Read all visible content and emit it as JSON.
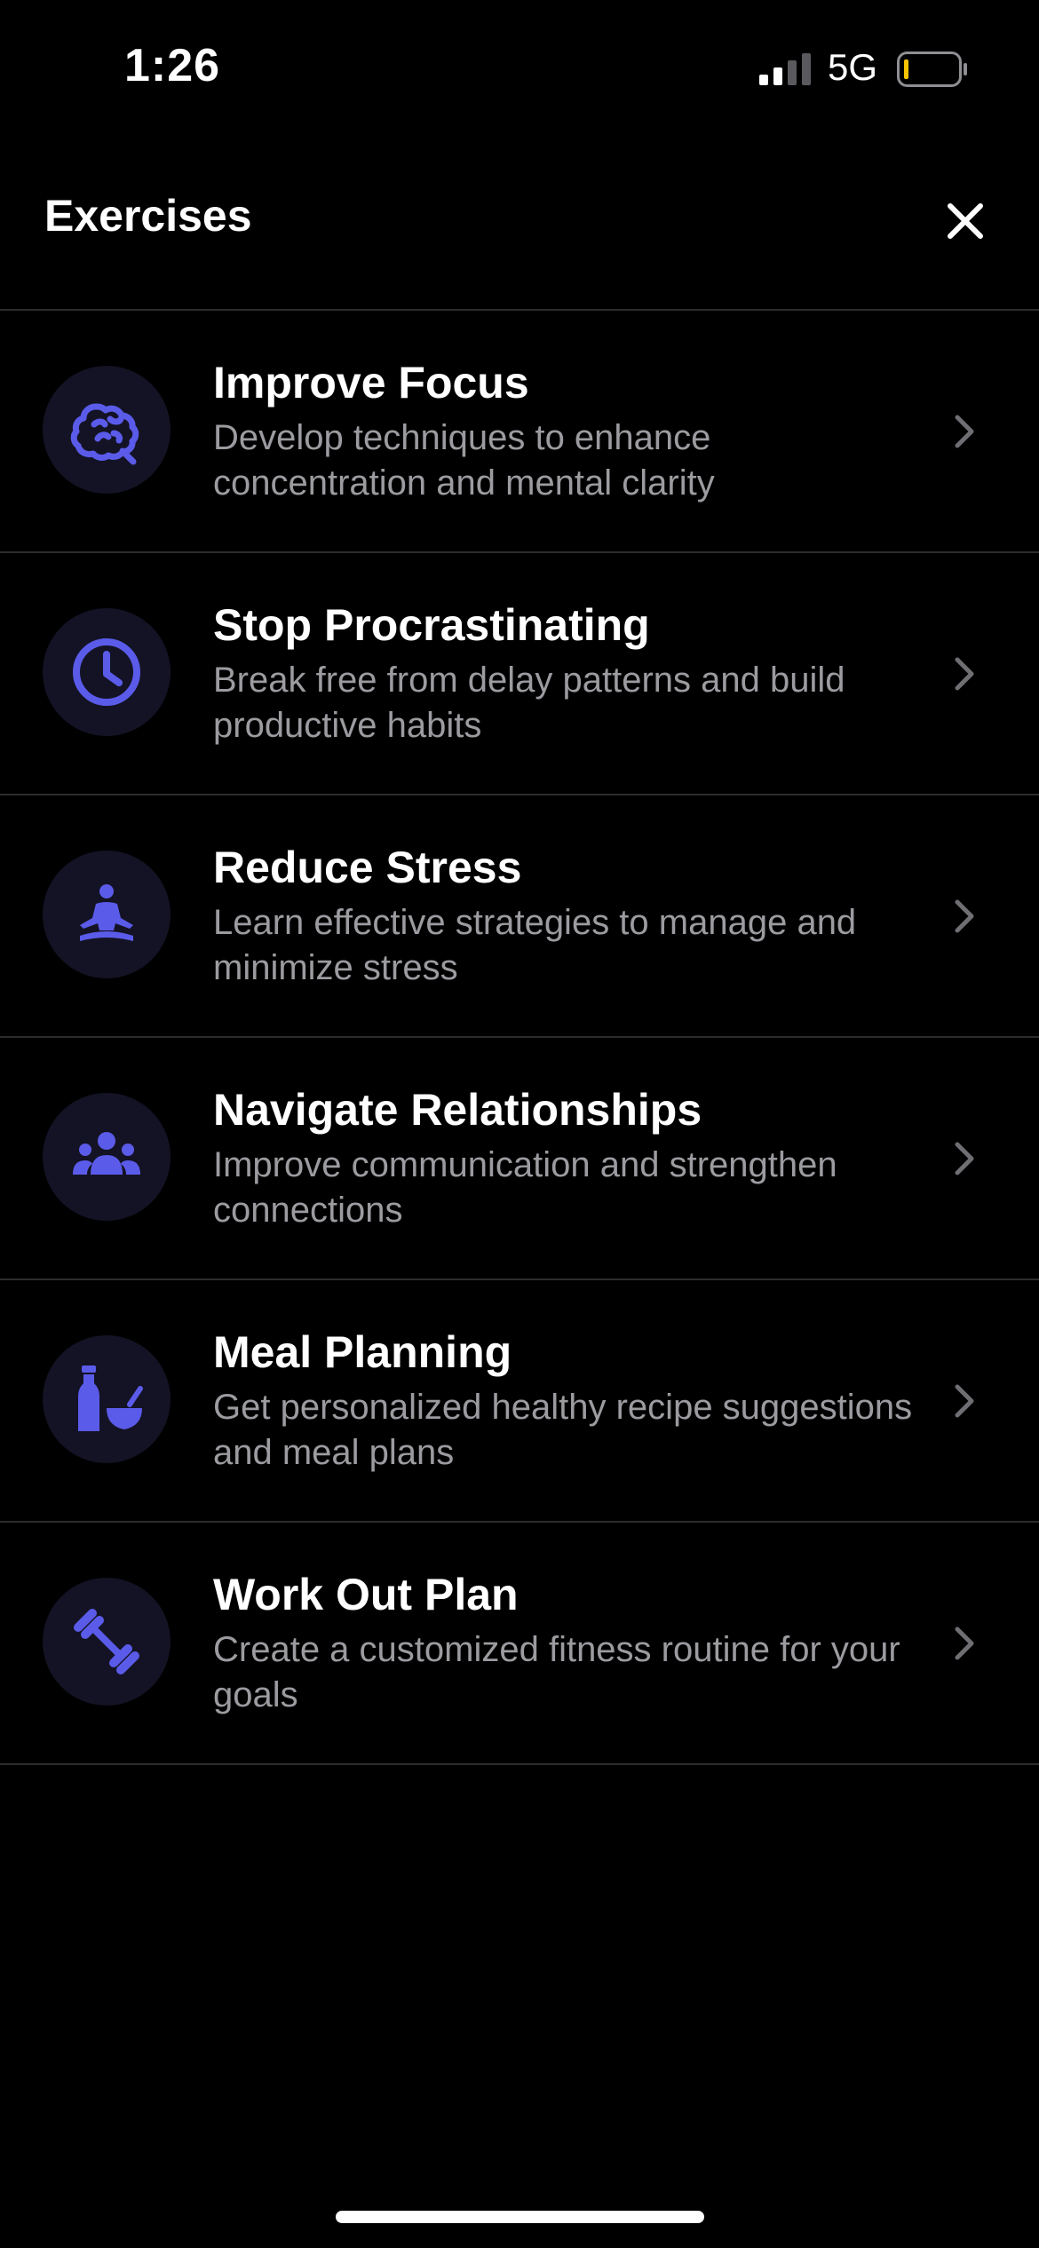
{
  "status_bar": {
    "time": "1:26",
    "network": "5G"
  },
  "header": {
    "title": "Exercises"
  },
  "accent_color": "#5b5bea",
  "exercises": [
    {
      "title": "Improve Focus",
      "description": "Develop techniques to enhance concentration and mental clarity",
      "icon": "brain-icon"
    },
    {
      "title": "Stop Procrastinating",
      "description": "Break free from delay patterns and build productive habits",
      "icon": "clock-icon"
    },
    {
      "title": "Reduce Stress",
      "description": "Learn effective strategies to manage and minimize stress",
      "icon": "meditation-icon"
    },
    {
      "title": "Navigate Relationships",
      "description": "Improve communication and strengthen connections",
      "icon": "people-icon"
    },
    {
      "title": "Meal Planning",
      "description": "Get personalized healthy recipe suggestions and meal plans",
      "icon": "meal-icon"
    },
    {
      "title": "Work Out Plan",
      "description": "Create a customized fitness routine for your goals",
      "icon": "dumbbell-icon"
    }
  ]
}
